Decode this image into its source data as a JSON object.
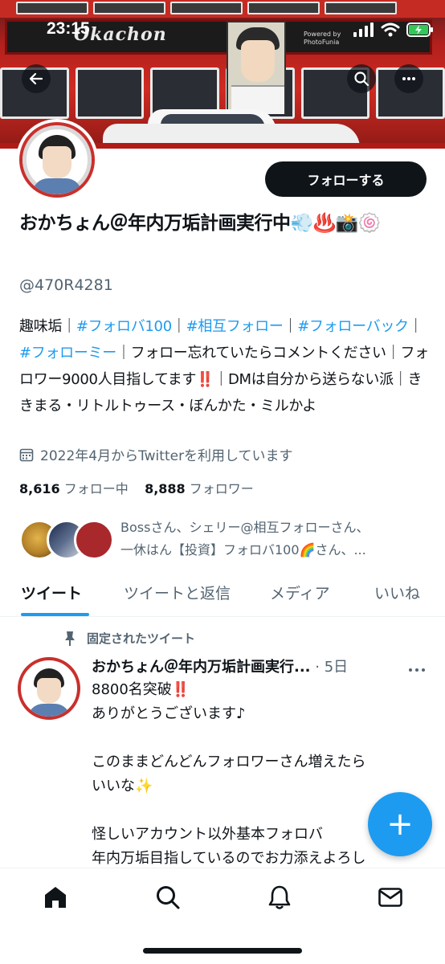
{
  "status_bar": {
    "time": "23:15"
  },
  "banner": {
    "sign_text": "Okachon",
    "watermark_line1": "Powered by",
    "watermark_line2": "PhotoFunia"
  },
  "header": {
    "back_icon": "arrow-left-icon",
    "search_icon": "search-icon",
    "more_icon": "more-horizontal-icon"
  },
  "profile": {
    "follow_button": "フォローする",
    "name": "おかちょん＠年内万垢計画実行中",
    "name_emojis": "💨♨️📸🍥",
    "handle": "@470R4281",
    "bio": {
      "prefix": "趣味垢｜",
      "tag1": "#フォロバ100",
      "sep1": "｜",
      "tag2": "#相互フォロー",
      "sep2": "｜",
      "tag3": "#フォローバック",
      "sep3": "｜",
      "tag4": "#フォローミー",
      "text1": "｜フォロー忘れていたらコメントください｜フォロワー9000人目指してます",
      "bang": "‼️",
      "text2": "｜DMは自分から送らない派｜ききまる・リトルトゥース・ぼんかた・ミルかよ"
    },
    "joined": "2022年4月からTwitterを利用しています",
    "following_count": "8,616",
    "following_label": "フォロー中",
    "followers_count": "8,888",
    "followers_label": "フォロワー",
    "followed_by_line1": "Bossさん、シェリー@相互フォローさん、",
    "followed_by_line2": "一休はん【投資】フォロバ100🌈さん、..."
  },
  "tabs": [
    {
      "label": "ツイート",
      "active": true
    },
    {
      "label": "ツイートと返信",
      "active": false
    },
    {
      "label": "メディア",
      "active": false
    },
    {
      "label": "いいね",
      "active": false
    }
  ],
  "pinned_tweet": {
    "pinned_label": "固定されたツイート",
    "author": "おかちょん＠年内万垢計画実行...",
    "time": "5日",
    "lines": [
      "8800名突破‼️",
      "ありがとうございます♪",
      "",
      "このままどんどんフォロワーさん増えたら",
      "いいな✨",
      "",
      "怪しいアカウント以外基本フォロバ",
      "年内万垢目指しているのでお力添えよろし"
    ]
  },
  "fab": {
    "label": "+"
  },
  "bottom_nav": [
    "home-icon",
    "search-icon",
    "notifications-bell-icon",
    "messages-envelope-icon"
  ],
  "colors": {
    "accent": "#1d9bf0",
    "text": "#0f1419",
    "muted": "#536471",
    "bang": "#e0245e"
  }
}
